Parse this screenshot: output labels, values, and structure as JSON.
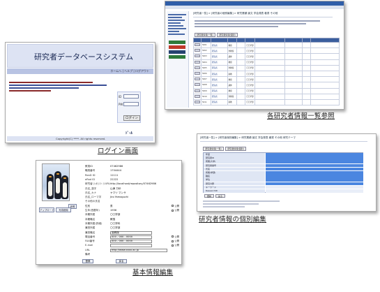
{
  "captions": {
    "login": "ログイン画面",
    "list": "各研究者情報一覧参照",
    "detail": "研究者情報の個別編集",
    "basic": "基本情報編集"
  },
  "login": {
    "system_title": "研究者データベースシステム",
    "login_button": "ログイン",
    "id_label": "ID",
    "pw_label": "PW",
    "footer_logo": "ﾄﾞｰﾙ",
    "copyright": "Copyright(C) ****. All rights reserved."
  },
  "list": {
    "breadcrumb": "[研究者一覧]  >  [研究者の個別編集]  >  研究業績  論文  学会発表  著書  その他",
    "tabs": [
      "研究者情報(一覧)",
      "研究者情報(個別)"
    ],
    "rows": [
      {
        "id": "5001",
        "name": "研究者",
        "dept": "〇〇学部",
        "title": "教授"
      },
      {
        "id": "5002",
        "name": "研究者",
        "dept": "〇〇学部",
        "title": "准教授"
      },
      {
        "id": "5003",
        "name": "研究者",
        "dept": "〇〇学部",
        "title": "講師"
      },
      {
        "id": "5004",
        "name": "研究者",
        "dept": "〇〇学部",
        "title": "教授"
      },
      {
        "id": "5005",
        "name": "研究者",
        "dept": "〇〇学部",
        "title": "准教授"
      },
      {
        "id": "5006",
        "name": "研究者",
        "dept": "〇〇学部",
        "title": "助教"
      },
      {
        "id": "5007",
        "name": "研究者",
        "dept": "〇〇学部",
        "title": "教授"
      },
      {
        "id": "5008",
        "name": "研究者",
        "dept": "〇〇学部",
        "title": "講師"
      },
      {
        "id": "5009",
        "name": "研究者",
        "dept": "〇〇学部",
        "title": "教授"
      },
      {
        "id": "5010",
        "name": "研究者",
        "dept": "〇〇学部",
        "title": "准教授"
      },
      {
        "id": "5011",
        "name": "研究者",
        "dept": "〇〇学部",
        "title": "助教"
      }
    ]
  },
  "detail": {
    "breadcrumb": "[研究者一覧]  >  [研究者個別編集]  >  研究業績  論文  学会発表  著書  その他  研究テーマ",
    "tabs": [
      "研究者情報(一覧)",
      "研究者情報(個別)"
    ],
    "fields": [
      "年度",
      "研究者ID",
      "所属(大学)",
      "研究者番号",
      "氏名",
      "所属(学部)",
      "職名",
      "学位",
      "研究分野",
      "キーワード",
      "ResearchID"
    ],
    "buttons": [
      "更新",
      "戻る"
    ]
  },
  "basic": {
    "photo_buttons": [
      "アップロード",
      "写真削除"
    ],
    "upload_button": "参照",
    "rows": [
      {
        "k": "教員ID",
        "v": "07462986",
        "pub": false
      },
      {
        "k": "職員番号",
        "v": "1704444",
        "pub": false
      },
      {
        "k": "ReaD ID",
        "v": "11111",
        "pub": false
      },
      {
        "k": "eRad ID",
        "v": "22222",
        "pub": false
      },
      {
        "k": "研究者リポジトリURL",
        "v": "http://localhost/repository/07462986",
        "pub": false
      },
      {
        "k": "氏名_漢字",
        "v": "山津 万紗",
        "pub": false
      },
      {
        "k": "氏名_カナ",
        "v": "ヤマツ マンサ",
        "pub": false
      },
      {
        "k": "氏名_ローマ字",
        "v": "Jiro Yamaguchi",
        "pub": false
      },
      {
        "k": "その他の氏名",
        "v": "",
        "pub": false
      },
      {
        "k": "性別",
        "v": "男",
        "pub": true
      },
      {
        "k": "生年(西暦年)",
        "v": "1956",
        "pub": true
      },
      {
        "k": "本籍所属",
        "v": "〇〇学部",
        "pub": false
      },
      {
        "k": "本籍職名",
        "v": "教授",
        "pub": false
      },
      {
        "k": "本籍所属(詳細)",
        "v": "〇〇学科",
        "pub": false
      },
      {
        "k": "兼担所属",
        "v": "〇〇学部",
        "pub": false
      },
      {
        "k": "兼担職名",
        "v": "准教授",
        "pub": false
      },
      {
        "k": "電話番号",
        "v": "000 - 000 - 0000",
        "pub": true
      },
      {
        "k": "FAX番号",
        "v": "000 - 000 - 0000",
        "pub": true
      },
      {
        "k": "E-mail",
        "v": "",
        "pub": true
      },
      {
        "k": "URL",
        "v": "http://www.xxxx.ac.jp",
        "pub": false
      },
      {
        "k": "備考",
        "v": "",
        "pub": false
      }
    ],
    "pub_label": "公開",
    "buttons": [
      "登録",
      "戻る"
    ]
  }
}
